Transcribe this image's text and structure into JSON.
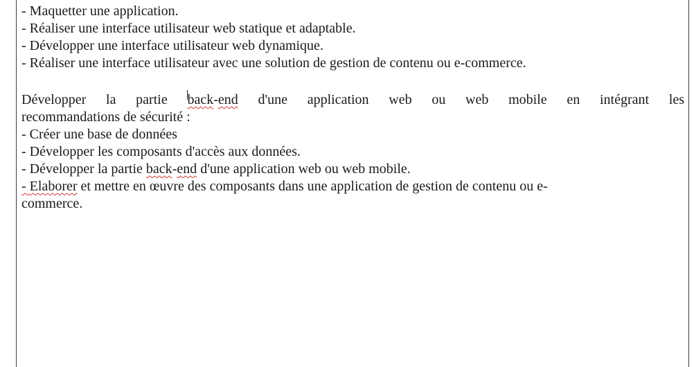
{
  "document": {
    "list1": [
      "- Maquetter une application.",
      "- Réaliser une interface utilisateur web statique et adaptable.",
      "- Développer une interface utilisateur web dynamique.",
      "- Réaliser une interface utilisateur avec une solution de gestion de contenu ou e-commerce."
    ],
    "para": {
      "before": "Développer la partie ",
      "word_a": "back",
      "dash": "-",
      "word_b": "end",
      "after_line1": " d'une application web ou web mobile en intégrant les",
      "line2": "recommandations de sécurité :"
    },
    "list2": {
      "item1": "- Créer une base de données",
      "item2": "- Développer les composants d'accès aux données.",
      "item3_before": "- Développer la partie ",
      "item3_word_a": "back",
      "item3_dash": "-",
      "item3_word_b": "end",
      "item3_after": " d'une application web ou web mobile.",
      "item4_dash": "- ",
      "item4_word": "Elaborer",
      "item4_after": " et mettre en œuvre des composants dans une application de gestion de contenu ou e-",
      "item4_line2": "commerce."
    }
  }
}
